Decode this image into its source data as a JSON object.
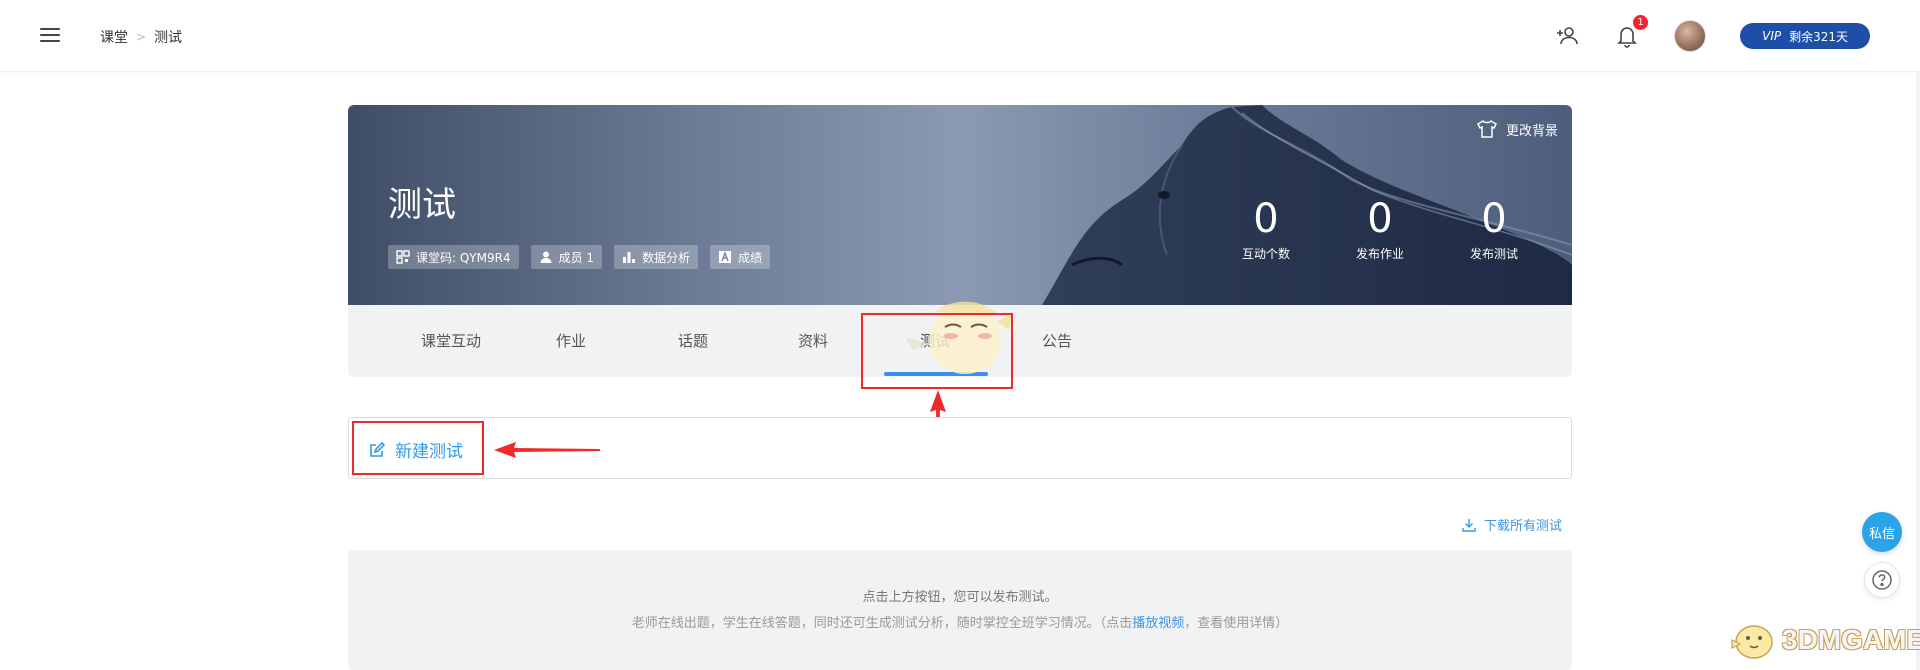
{
  "header": {
    "breadcrumb_root": "课堂",
    "breadcrumb_separator": ">",
    "breadcrumb_current": "测试",
    "notification_count": "1",
    "vip_tag": "VIP",
    "vip_text": "剩余321天"
  },
  "banner": {
    "title": "测试",
    "change_background": "更改背景",
    "tags": {
      "class_code": "课堂码: QYM9R4",
      "members": "成员 1",
      "analysis": "数据分析",
      "grades": "成绩"
    },
    "stats": [
      {
        "value": "0",
        "label": "互动个数"
      },
      {
        "value": "0",
        "label": "发布作业"
      },
      {
        "value": "0",
        "label": "发布测试"
      }
    ]
  },
  "tabs": [
    {
      "label": "课堂互动"
    },
    {
      "label": "作业"
    },
    {
      "label": "话题"
    },
    {
      "label": "资料"
    },
    {
      "label": "测试"
    },
    {
      "label": "公告"
    }
  ],
  "active_tab": "测试",
  "actions": {
    "new_test": "新建测试",
    "download_all": "下载所有测试"
  },
  "empty_state": {
    "line1": "点击上方按钮，您可以发布测试。",
    "line2_before": "老师在线出题，学生在线答题，同时还可生成测试分析，随时掌控全班学习情况。（点击",
    "line2_link": "播放视频",
    "line2_after": "，查看使用详情）"
  },
  "floating": {
    "message": "私信"
  },
  "watermark": "3DMGAME",
  "colors": {
    "accent": "#3d8cf0",
    "link": "#2f9be6",
    "vip": "#1e4fa8",
    "highlight": "#f02a2a",
    "badge": "#f5222d"
  }
}
